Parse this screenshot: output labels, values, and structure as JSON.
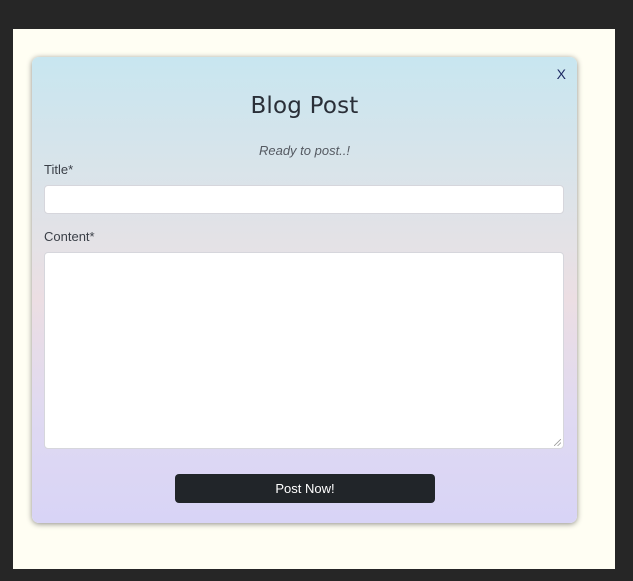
{
  "modal": {
    "close_label": "X",
    "title": "Blog Post",
    "subtitle": "Ready to post..!"
  },
  "form": {
    "title_label": "Title*",
    "title_value": "",
    "content_label": "Content*",
    "content_value": "",
    "submit_label": "Post Now!"
  }
}
